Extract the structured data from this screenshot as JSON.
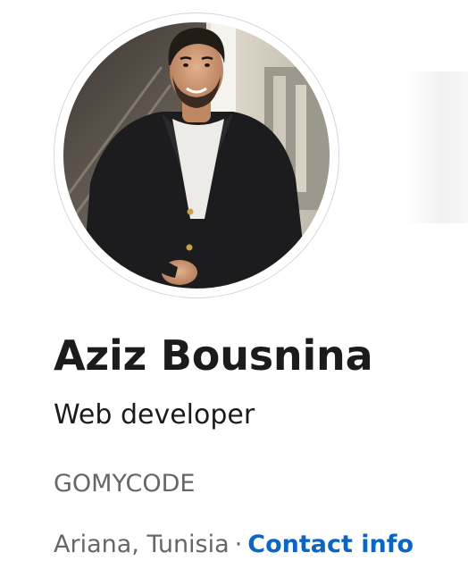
{
  "profile": {
    "name": "Aziz Bousnina",
    "headline": "Web developer",
    "company": "GOMYCODE",
    "location": "Ariana, Tunisia",
    "separator": "·",
    "contact_label": "Contact info"
  },
  "colors": {
    "link": "#0a66c2",
    "primary_text": "#1b1b1b",
    "secondary_text": "#666666"
  }
}
